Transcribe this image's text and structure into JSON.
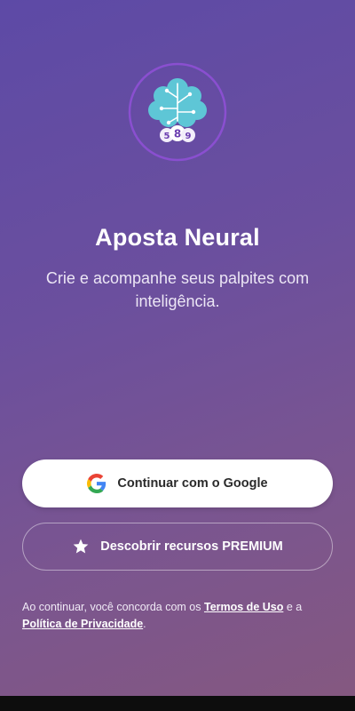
{
  "brand": {
    "logo_digits": "5 8 9",
    "icon": "brain-logo-icon"
  },
  "hero": {
    "title": "Aposta Neural",
    "subtitle": "Crie e acompanhe seus palpites com inteligência."
  },
  "actions": {
    "google_label": "Continuar com o Google",
    "google_icon": "google-icon",
    "premium_label": "Descobrir recursos PREMIUM",
    "premium_icon": "star-icon"
  },
  "legal": {
    "prefix": "Ao continuar, você concorda com os ",
    "terms": "Termos de Uso",
    "middle": " e a ",
    "privacy": "Política de Privacidade",
    "suffix": "."
  },
  "colors": {
    "background_top": "#5d4aa6",
    "background_bottom": "#85587f",
    "brain": "#5ec6d6",
    "logo_ring": "#8a4fd0"
  }
}
